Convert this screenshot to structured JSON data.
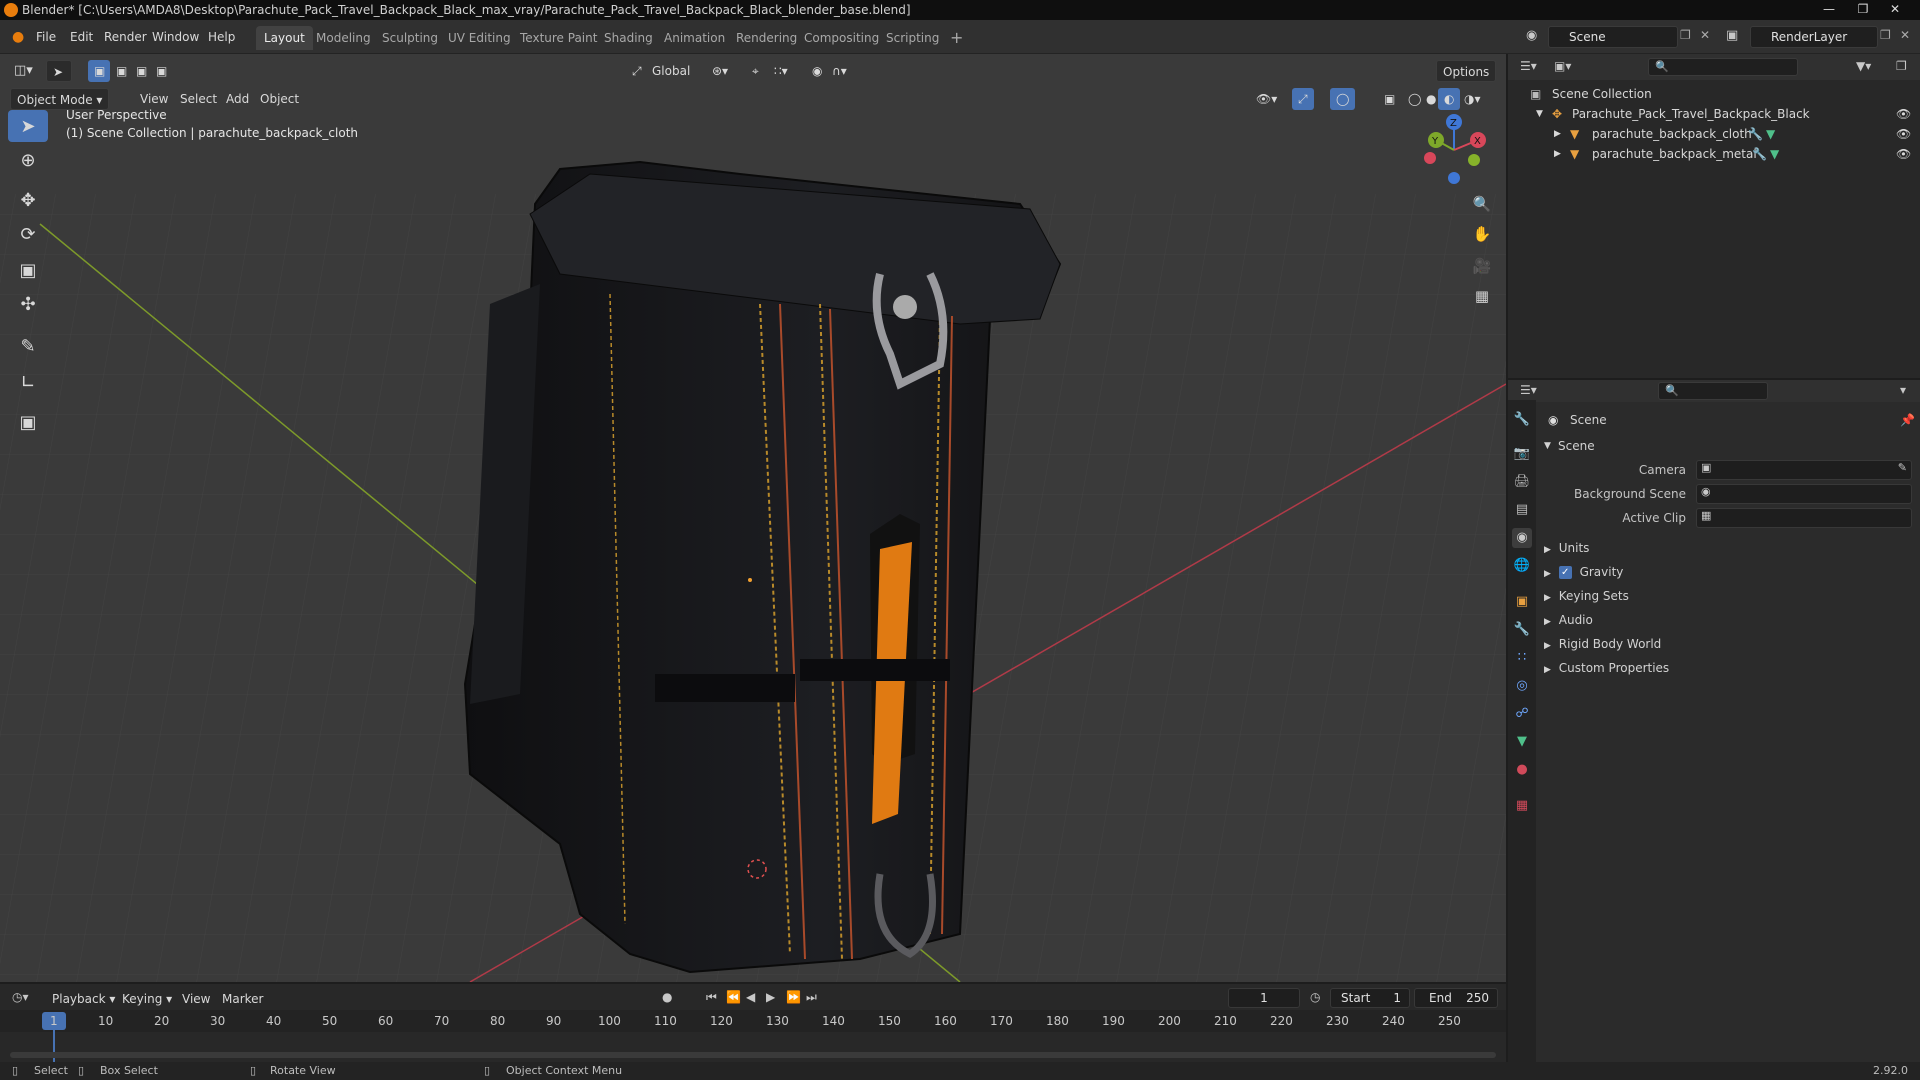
{
  "window": {
    "title": "Blender* [C:\\Users\\AMDA8\\Desktop\\Parachute_Pack_Travel_Backpack_Black_max_vray/Parachute_Pack_Travel_Backpack_Black_blender_base.blend]"
  },
  "menu": [
    "File",
    "Edit",
    "Render",
    "Window",
    "Help"
  ],
  "workspaces": [
    "Layout",
    "Modeling",
    "Sculpting",
    "UV Editing",
    "Texture Paint",
    "Shading",
    "Animation",
    "Rendering",
    "Compositing",
    "Scripting"
  ],
  "active_workspace": "Layout",
  "scene_field": "Scene",
  "renderlayer_field": "RenderLayer",
  "viewport": {
    "transform_orientation": "Global",
    "options_label": "Options",
    "mode": "Object Mode",
    "menus": [
      "View",
      "Select",
      "Add",
      "Object"
    ],
    "overlay_line1": "User Perspective",
    "overlay_line2": "(1) Scene Collection | parachute_backpack_cloth",
    "gizmo_axes": [
      "X",
      "Y",
      "Z"
    ],
    "colors": {
      "background": "#3b3b3b",
      "grid": "#444444",
      "x_axis": "#b03a48",
      "y_axis": "#7d9a2a",
      "accent": "#4772b3"
    }
  },
  "outliner": {
    "root": "Scene Collection",
    "collection": "Parachute_Pack_Travel_Backpack_Black",
    "objects": [
      "parachute_backpack_cloth",
      "parachute_backpack_metal"
    ]
  },
  "properties": {
    "header": "Scene",
    "panel": "Scene",
    "fields": [
      {
        "label": "Camera",
        "value": ""
      },
      {
        "label": "Background Scene",
        "value": ""
      },
      {
        "label": "Active Clip",
        "value": ""
      }
    ],
    "sections": [
      "Units",
      "Gravity",
      "Keying Sets",
      "Audio",
      "Rigid Body World",
      "Custom Properties"
    ],
    "gravity_checked": true
  },
  "timeline": {
    "menus": [
      "Playback",
      "Keying",
      "View",
      "Marker"
    ],
    "current_frame": "1",
    "start_label": "Start",
    "start_value": "1",
    "end_label": "End",
    "end_value": "250",
    "ruler": [
      "1",
      "10",
      "20",
      "30",
      "40",
      "50",
      "60",
      "70",
      "80",
      "90",
      "100",
      "110",
      "120",
      "130",
      "140",
      "150",
      "160",
      "170",
      "180",
      "190",
      "200",
      "210",
      "220",
      "230",
      "240",
      "250"
    ]
  },
  "statusbar": {
    "select": "Select",
    "box_select": "Box Select",
    "rotate": "Rotate View",
    "context_menu": "Object Context Menu",
    "version": "2.92.0"
  }
}
